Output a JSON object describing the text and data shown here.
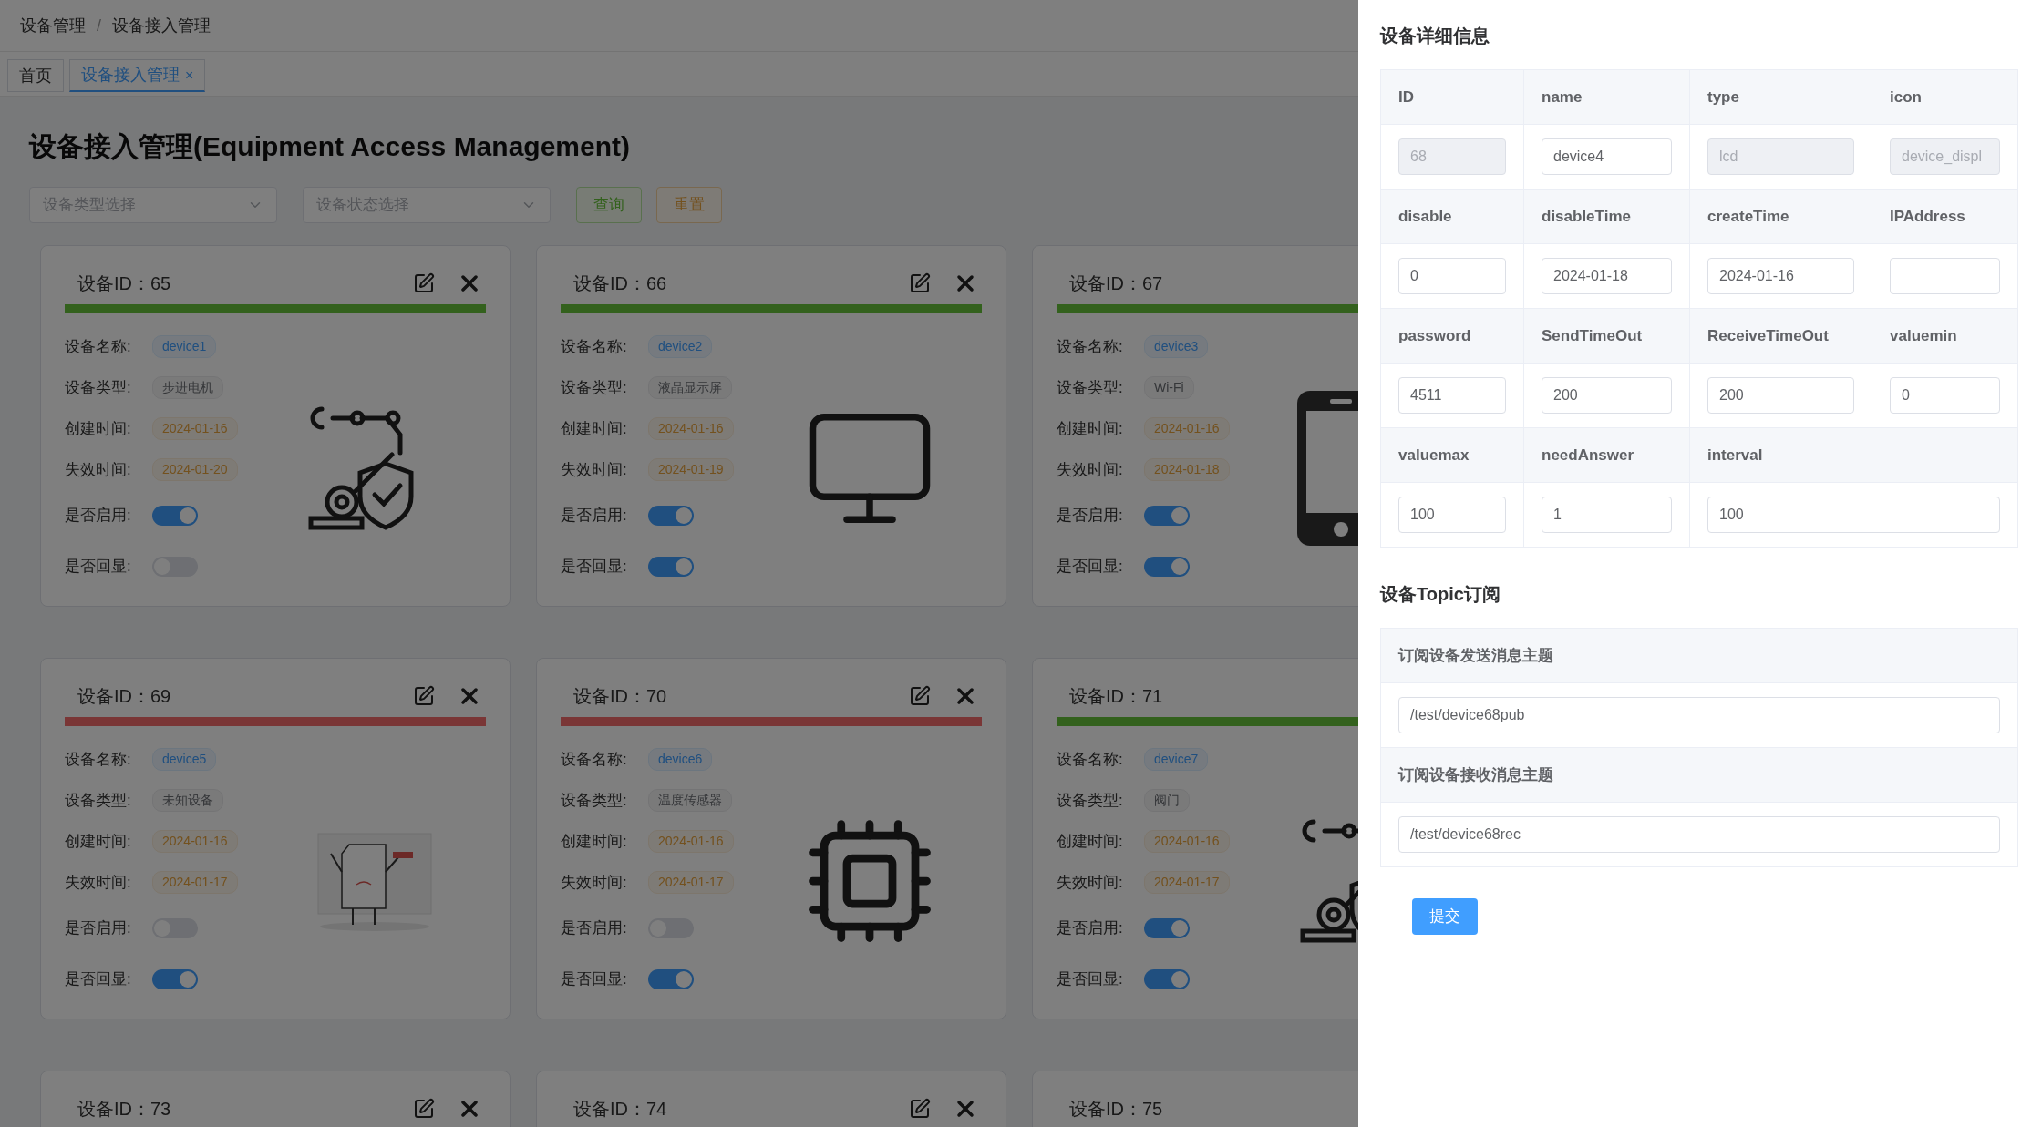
{
  "breadcrumb": [
    "设备管理",
    "设备接入管理"
  ],
  "breadcrumb_separator": "/",
  "tabs": [
    {
      "label": "首页",
      "selected": false
    },
    {
      "label": "设备接入管理",
      "selected": true,
      "close": "×"
    }
  ],
  "page_title": "设备接入管理(Equipment Access Management)",
  "filters": {
    "type_placeholder": "设备类型选择",
    "status_placeholder": "设备状态选择",
    "query_button": "查询",
    "reset_button": "重置"
  },
  "cards": [
    {
      "title": "设备ID：65",
      "online": true,
      "kind": "robot",
      "fields": [
        {
          "label": "设备名称:",
          "value": "device1",
          "kind": "name"
        },
        {
          "label": "设备类型:",
          "value": "步进电机",
          "kind": "type"
        },
        {
          "label": "创建时间:",
          "value": "2024-01-16",
          "kind": "date"
        },
        {
          "label": "失效时间:",
          "value": "2024-01-20",
          "kind": "date"
        }
      ],
      "toggles": [
        {
          "label": "是否启用:",
          "on": true
        },
        {
          "label": "是否回显:",
          "on": false
        }
      ]
    },
    {
      "title": "设备ID：66",
      "online": true,
      "kind": "monitor",
      "fields": [
        {
          "label": "设备名称:",
          "value": "device2",
          "kind": "name"
        },
        {
          "label": "设备类型:",
          "value": "液晶显示屏",
          "kind": "type"
        },
        {
          "label": "创建时间:",
          "value": "2024-01-16",
          "kind": "date"
        },
        {
          "label": "失效时间:",
          "value": "2024-01-19",
          "kind": "date"
        }
      ],
      "toggles": [
        {
          "label": "是否启用:",
          "on": true
        },
        {
          "label": "是否回显:",
          "on": true
        }
      ]
    },
    {
      "title": "设备ID：67",
      "online": true,
      "kind": "phone",
      "fields": [
        {
          "label": "设备名称:",
          "value": "device3",
          "kind": "name"
        },
        {
          "label": "设备类型:",
          "value": "Wi-Fi",
          "kind": "type"
        },
        {
          "label": "创建时间:",
          "value": "2024-01-16",
          "kind": "date"
        },
        {
          "label": "失效时间:",
          "value": "2024-01-18",
          "kind": "date"
        }
      ],
      "toggles": [
        {
          "label": "是否启用:",
          "on": true
        },
        {
          "label": "是否回显:",
          "on": true
        }
      ]
    },
    {
      "title": "设备ID：69",
      "online": false,
      "kind": "error",
      "fields": [
        {
          "label": "设备名称:",
          "value": "device5",
          "kind": "name"
        },
        {
          "label": "设备类型:",
          "value": "未知设备",
          "kind": "type"
        },
        {
          "label": "创建时间:",
          "value": "2024-01-16",
          "kind": "date"
        },
        {
          "label": "失效时间:",
          "value": "2024-01-17",
          "kind": "date"
        }
      ],
      "toggles": [
        {
          "label": "是否启用:",
          "on": false
        },
        {
          "label": "是否回显:",
          "on": true
        }
      ]
    },
    {
      "title": "设备ID：70",
      "online": false,
      "kind": "chip",
      "fields": [
        {
          "label": "设备名称:",
          "value": "device6",
          "kind": "name"
        },
        {
          "label": "设备类型:",
          "value": "温度传感器",
          "kind": "type"
        },
        {
          "label": "创建时间:",
          "value": "2024-01-16",
          "kind": "date"
        },
        {
          "label": "失效时间:",
          "value": "2024-01-17",
          "kind": "date"
        }
      ],
      "toggles": [
        {
          "label": "是否启用:",
          "on": false
        },
        {
          "label": "是否回显:",
          "on": true
        }
      ]
    },
    {
      "title": "设备ID：71",
      "online": true,
      "kind": "robot",
      "fields": [
        {
          "label": "设备名称:",
          "value": "device7",
          "kind": "name"
        },
        {
          "label": "设备类型:",
          "value": "阀门",
          "kind": "type"
        },
        {
          "label": "创建时间:",
          "value": "2024-01-16",
          "kind": "date"
        },
        {
          "label": "失效时间:",
          "value": "2024-01-17",
          "kind": "date"
        }
      ],
      "toggles": [
        {
          "label": "是否启用:",
          "on": true
        },
        {
          "label": "是否回显:",
          "on": true
        }
      ]
    },
    {
      "title": "设备ID：73"
    },
    {
      "title": "设备ID：74"
    },
    {
      "title": "设备ID：75"
    }
  ],
  "drawer": {
    "title": "设备详细信息",
    "detail_rows": [
      [
        {
          "label": "ID",
          "value": "68",
          "disabled": true
        },
        {
          "label": "name",
          "value": "device4",
          "disabled": false
        },
        {
          "label": "type",
          "value": "lcd",
          "disabled": true
        },
        {
          "label": "icon",
          "value": "device_displ",
          "disabled": true
        }
      ],
      [
        {
          "label": "disable",
          "value": "0",
          "disabled": false
        },
        {
          "label": "disableTime",
          "value": "2024-01-18",
          "disabled": false
        },
        {
          "label": "createTime",
          "value": "2024-01-16",
          "disabled": false
        },
        {
          "label": "IPAddress",
          "disabled": false
        }
      ],
      [
        {
          "label": "password",
          "value": "4511",
          "disabled": false
        },
        {
          "label": "SendTimeOut",
          "value": "200",
          "disabled": false
        },
        {
          "label": "ReceiveTimeOut",
          "value": "200",
          "disabled": false
        },
        {
          "label": "valuemin",
          "value": "0",
          "disabled": false
        }
      ],
      [
        {
          "label": "valuemax",
          "value": "100",
          "disabled": false
        },
        {
          "label": "needAnswer",
          "value": "1",
          "disabled": false
        },
        {
          "label": "interval",
          "value": "100",
          "disabled": false
        }
      ]
    ],
    "topic_title": "设备Topic订阅",
    "topics": [
      {
        "label": "订阅设备发送消息主题",
        "value": "/test/device68pub"
      },
      {
        "label": "订阅设备接收消息主题",
        "value": "/test/device68rec"
      }
    ],
    "submit": "提交"
  }
}
